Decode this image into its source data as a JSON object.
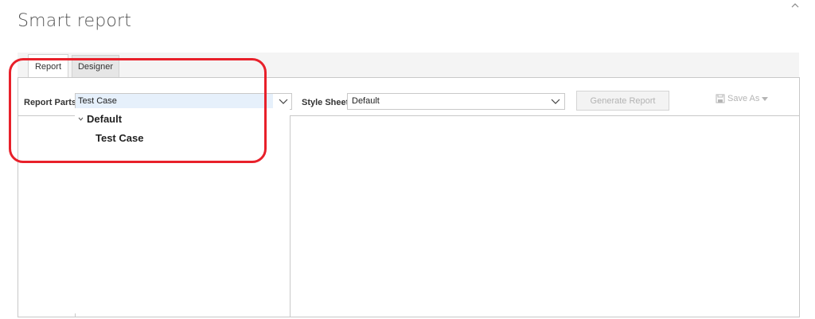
{
  "window": {
    "title": "Smart report"
  },
  "tabs": [
    {
      "label": "Report",
      "active": true
    },
    {
      "label": "Designer",
      "active": false
    }
  ],
  "toolbar": {
    "report_parts_label": "Report Parts:",
    "report_parts_value": "Test Case",
    "style_sheet_label": "Style Sheet:",
    "style_sheet_value": "Default",
    "generate_label": "Generate Report",
    "save_as_label": "Save As"
  },
  "tree": {
    "group_label": "Default",
    "item_label": "Test Case"
  },
  "colors": {
    "highlight": "#e8202a",
    "selection": "#e6f0fb"
  },
  "icons": [
    "collapse-chevron-up-icon",
    "chevron-down-icon",
    "save-icon",
    "caret-down-icon",
    "expand-chevron-icon"
  ]
}
